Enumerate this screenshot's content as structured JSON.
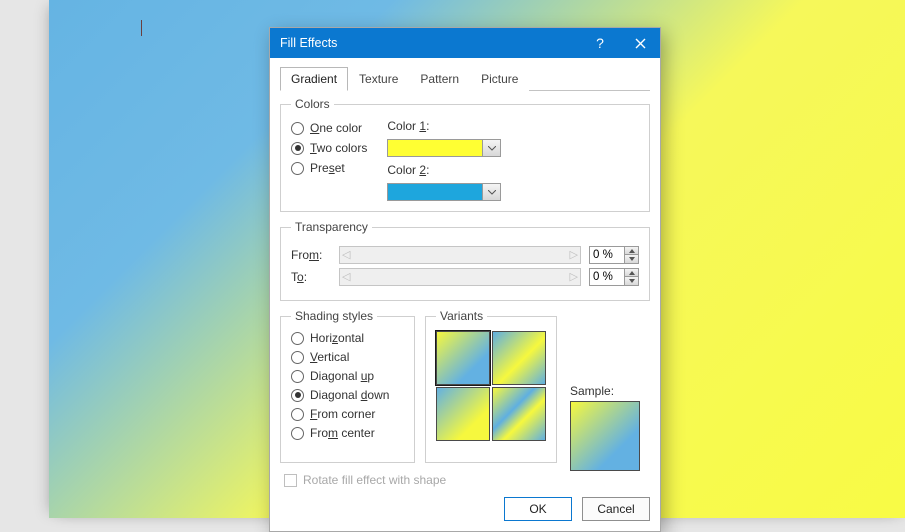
{
  "dialog": {
    "title": "Fill Effects",
    "help": "?",
    "tabs": {
      "gradient": "Gradient",
      "texture": "Texture",
      "pattern": "Pattern",
      "picture": "Picture"
    }
  },
  "colors": {
    "legend": "Colors",
    "one": "ne color",
    "two": "wo colors",
    "preset": "Pre",
    "preset2": "et",
    "color1_label": "Color ",
    "color1_num": "1",
    "color1_suffix": ":",
    "color2_label": "Color ",
    "color2_num": "2",
    "color2_suffix": ":"
  },
  "transparency": {
    "legend": "Transparency",
    "from": "Fro",
    "from_u": "m",
    "from_suffix": ":",
    "to_u": "o",
    "to_suffix": ":",
    "T": "T",
    "from_val": "0 %",
    "to_val": "0 %"
  },
  "shading": {
    "legend": "Shading styles",
    "horizontal": "Hori",
    "horizontal_u": "z",
    "horizontal2": "ontal",
    "vertical_u": "V",
    "vertical": "ertical",
    "diagup": "Diagonal ",
    "diagup_u": "u",
    "diagup2": "p",
    "diagdown": "Diagonal ",
    "diagdown_u": "d",
    "diagdown2": "own",
    "fromcorner_u": "F",
    "fromcorner": "rom corner",
    "fromcenter": "Fro",
    "fromcenter_u": "m",
    "fromcenter2": " center"
  },
  "variants": {
    "legend": "Variants"
  },
  "sample": {
    "label": "Sample:"
  },
  "rotate": {
    "label": "Rotate fill effect with shape",
    "suffix": ""
  },
  "rotate_full": "Rotate fill effect with shape",
  "footer": {
    "ok": "OK",
    "cancel": "Cancel"
  },
  "letters": {
    "O": "O",
    "T": "T",
    "s": "s"
  }
}
